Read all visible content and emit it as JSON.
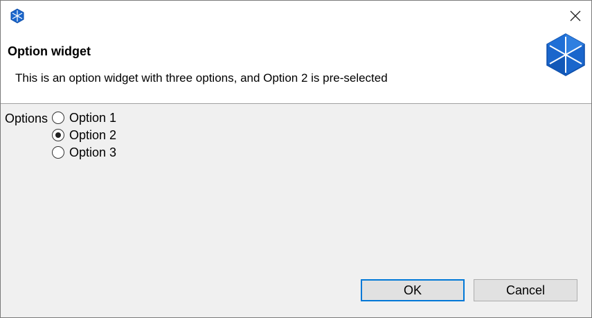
{
  "dialog": {
    "title": "Option widget",
    "description": "This is an option widget with three options, and Option 2 is pre-selected"
  },
  "options": {
    "label": "Options",
    "items": [
      {
        "label": "Option 1",
        "checked": false
      },
      {
        "label": "Option 2",
        "checked": true
      },
      {
        "label": "Option 3",
        "checked": false
      }
    ]
  },
  "buttons": {
    "ok_label": "OK",
    "cancel_label": "Cancel"
  },
  "icons": {
    "app": "app-logo-icon",
    "close": "close-icon",
    "header": "app-logo-icon"
  },
  "colors": {
    "accent": "#0078d7",
    "logo": "#1a66cc"
  }
}
